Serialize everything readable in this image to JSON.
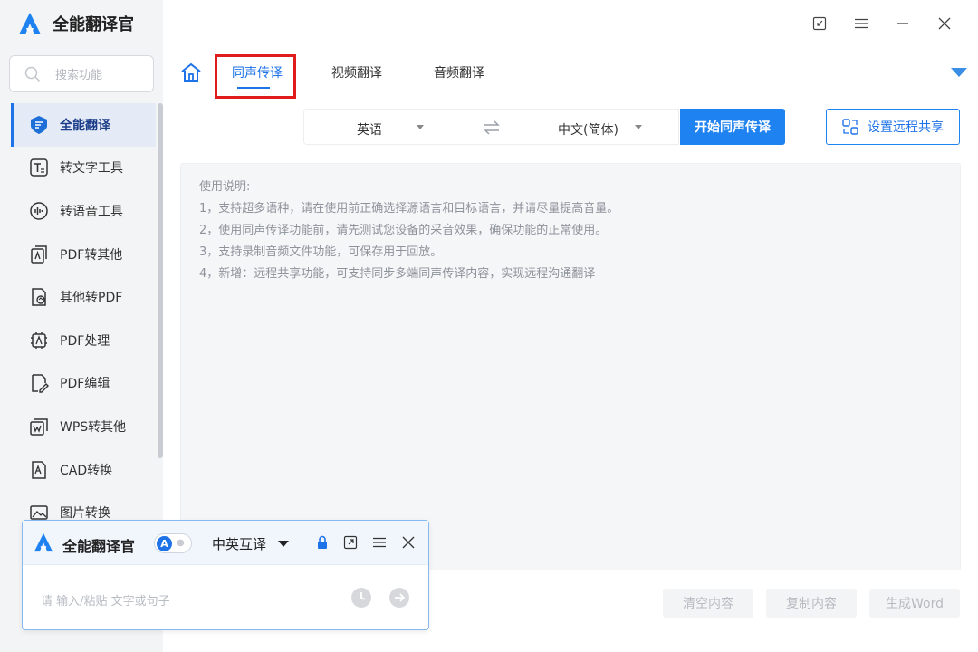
{
  "app": {
    "title": "全能翻译官"
  },
  "sidebar": {
    "search_placeholder": "搜索功能",
    "items": [
      {
        "label": "全能翻译",
        "icon": "translate-shield-icon",
        "active": true
      },
      {
        "label": "转文字工具",
        "icon": "text-tool-icon"
      },
      {
        "label": "转语音工具",
        "icon": "voice-tool-icon"
      },
      {
        "label": "PDF转其他",
        "icon": "pdf-convert-icon"
      },
      {
        "label": "其他转PDF",
        "icon": "to-pdf-icon"
      },
      {
        "label": "PDF处理",
        "icon": "pdf-process-icon"
      },
      {
        "label": "PDF编辑",
        "icon": "pdf-edit-icon"
      },
      {
        "label": "WPS转其他",
        "icon": "wps-convert-icon"
      },
      {
        "label": "CAD转换",
        "icon": "cad-icon"
      },
      {
        "label": "图片转换",
        "icon": "image-convert-icon"
      }
    ]
  },
  "tabs": [
    {
      "label": "同声传译",
      "active": true
    },
    {
      "label": "视频翻译"
    },
    {
      "label": "音频翻译"
    }
  ],
  "translate": {
    "source_lang": "英语",
    "target_lang": "中文(简体)",
    "start_label": "开始同声传译",
    "remote_label": "设置远程共享"
  },
  "instructions": {
    "heading": "使用说明:",
    "lines": [
      "1，支持超多语种，请在使用前正确选择源语言和目标语言，并请尽量提高音量。",
      "2，使用同声传译功能前，请先测试您设备的采音效果，确保功能的正常使用。",
      "3，支持录制音频文件功能，可保存用于回放。",
      "4，新增：远程共享功能，可支持同步多端同声传译内容，实现远程沟通翻译"
    ]
  },
  "actions": {
    "clear_label": "清空内容",
    "copy_label": "复制内容",
    "word_label": "生成Word"
  },
  "mini": {
    "title": "全能翻译官",
    "toggle_letter": "A",
    "mode": "中英互译",
    "input_placeholder": "请 输入/粘贴 文字或句子"
  },
  "colors": {
    "accent": "#1e82f0",
    "highlight": "#e01c1c",
    "sidebar_bg": "#f3f4f6"
  }
}
